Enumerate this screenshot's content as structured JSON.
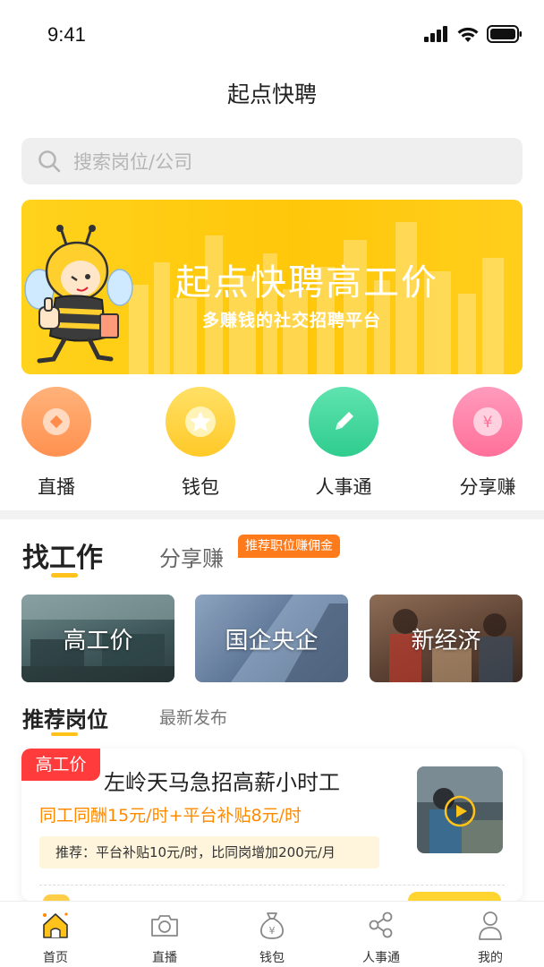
{
  "status_bar": {
    "time": "9:41"
  },
  "nav": {
    "title": "起点快聘"
  },
  "search": {
    "placeholder": "搜索岗位/公司"
  },
  "banner": {
    "title": "起点快聘高工价",
    "subtitle": "多赚钱的社交招聘平台"
  },
  "quick_actions": [
    {
      "label": "直播",
      "icon": "coin-icon",
      "color": "#ff9d5c"
    },
    {
      "label": "钱包",
      "icon": "star-icon",
      "color": "#ffd23a"
    },
    {
      "label": "人事通",
      "icon": "pencil-icon",
      "color": "#3fd49a"
    },
    {
      "label": "分享赚",
      "icon": "yen-icon",
      "color": "#ff7fa6"
    }
  ],
  "work_tabs": {
    "find": "找工作",
    "share": "分享赚",
    "share_badge": "推荐职位赚佣金"
  },
  "categories": [
    {
      "label": "高工价"
    },
    {
      "label": "国企央企"
    },
    {
      "label": "新经济"
    }
  ],
  "recommend": {
    "title": "推荐岗位",
    "latest": "最新发布"
  },
  "job": {
    "tag": "高工价",
    "title": "左岭天马急招高薪小时工",
    "wage": "同工同酬15元/时+平台补贴8元/时",
    "recommend_note": "推荐：平台补贴10元/时，比同岗增加200元/月"
  },
  "tabbar": [
    {
      "label": "首页",
      "icon": "home-icon",
      "active": true
    },
    {
      "label": "直播",
      "icon": "camera-icon",
      "active": false
    },
    {
      "label": "钱包",
      "icon": "money-bag-icon",
      "active": false
    },
    {
      "label": "人事通",
      "icon": "share-nodes-icon",
      "active": false
    },
    {
      "label": "我的",
      "icon": "user-icon",
      "active": false
    }
  ],
  "colors": {
    "accent": "#ffc21a",
    "orange": "#ff8a00",
    "tag_red": "#ff3b3b"
  }
}
